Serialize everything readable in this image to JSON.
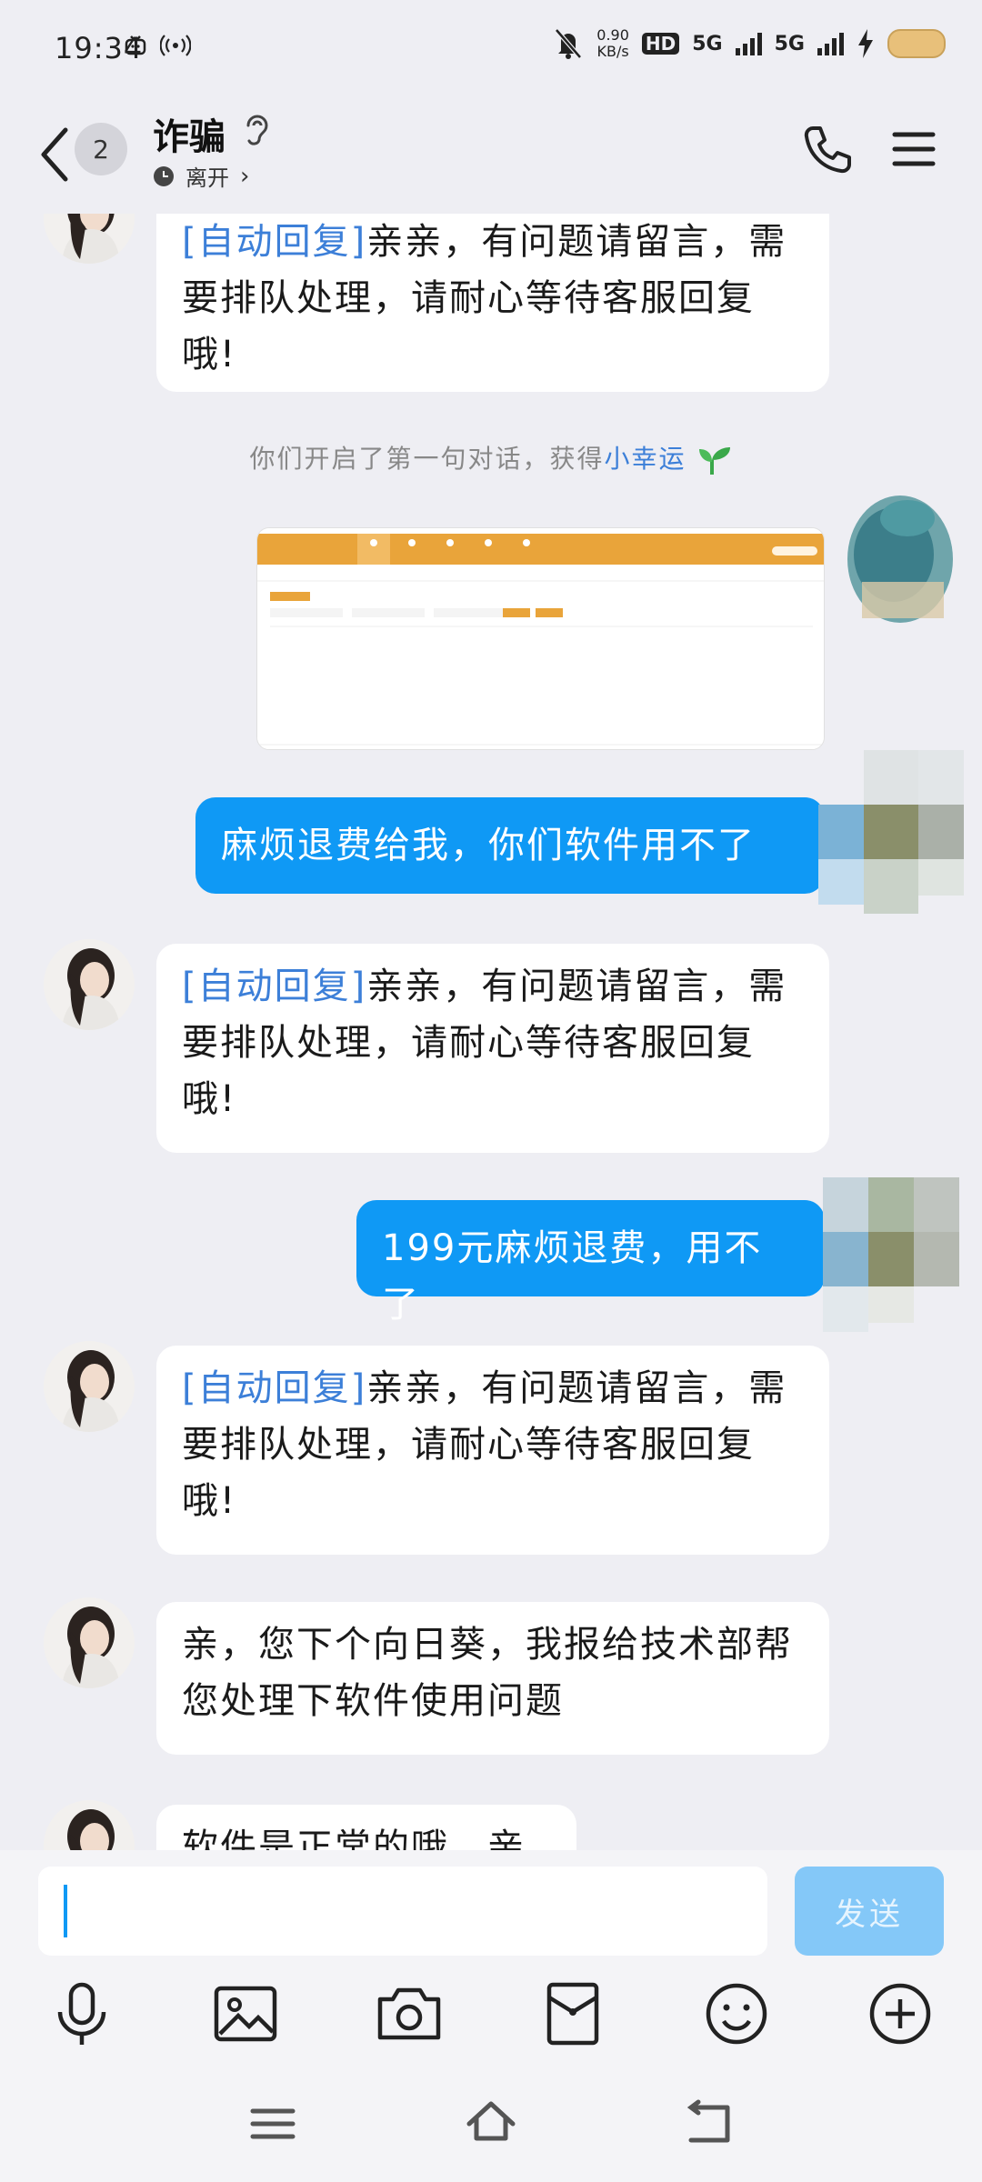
{
  "status_bar": {
    "time": "19:34",
    "speed_value": "0.90",
    "speed_unit": "KB/s",
    "hd_badge": "HD",
    "net1": "5G",
    "net2": "5G"
  },
  "header": {
    "unread_count": "2",
    "title": "诈骗",
    "status": "离开"
  },
  "messages": [
    {
      "type": "in",
      "tag": "[自动回复]",
      "text": "亲亲，有问题请留言，需要排队处理，请耐心等待客服回复哦!"
    },
    {
      "type": "system",
      "text": "你们开启了第一句对话，获得",
      "link": "小幸运"
    },
    {
      "type": "out_image"
    },
    {
      "type": "out",
      "text": "麻烦退费给我，你们软件用不了"
    },
    {
      "type": "in",
      "tag": "[自动回复]",
      "text": "亲亲，有问题请留言，需要排队处理，请耐心等待客服回复哦!"
    },
    {
      "type": "out",
      "text": "199元麻烦退费，用不了"
    },
    {
      "type": "in",
      "tag": "[自动回复]",
      "text": "亲亲，有问题请留言，需要排队处理，请耐心等待客服回复哦!"
    },
    {
      "type": "in",
      "text": "亲，您下个向日葵，我报给技术部帮您处理下软件使用问题"
    },
    {
      "type": "in",
      "text": "软件是正常的哦，亲"
    }
  ],
  "input": {
    "placeholder": "",
    "send_label": "发送"
  },
  "toolbar": {
    "icons": [
      "microphone-icon",
      "image-icon",
      "camera-icon",
      "red-packet-icon",
      "emoji-icon",
      "plus-icon"
    ]
  },
  "navbar": {
    "icons": [
      "menu-icon",
      "home-icon",
      "back-icon"
    ]
  },
  "colors": {
    "outgoing_bubble": "#0f99f5",
    "incoming_bubble": "#ffffff",
    "background": "#eeeef3",
    "tag": "#3c7fd8",
    "send_button": "#84c8f8"
  }
}
